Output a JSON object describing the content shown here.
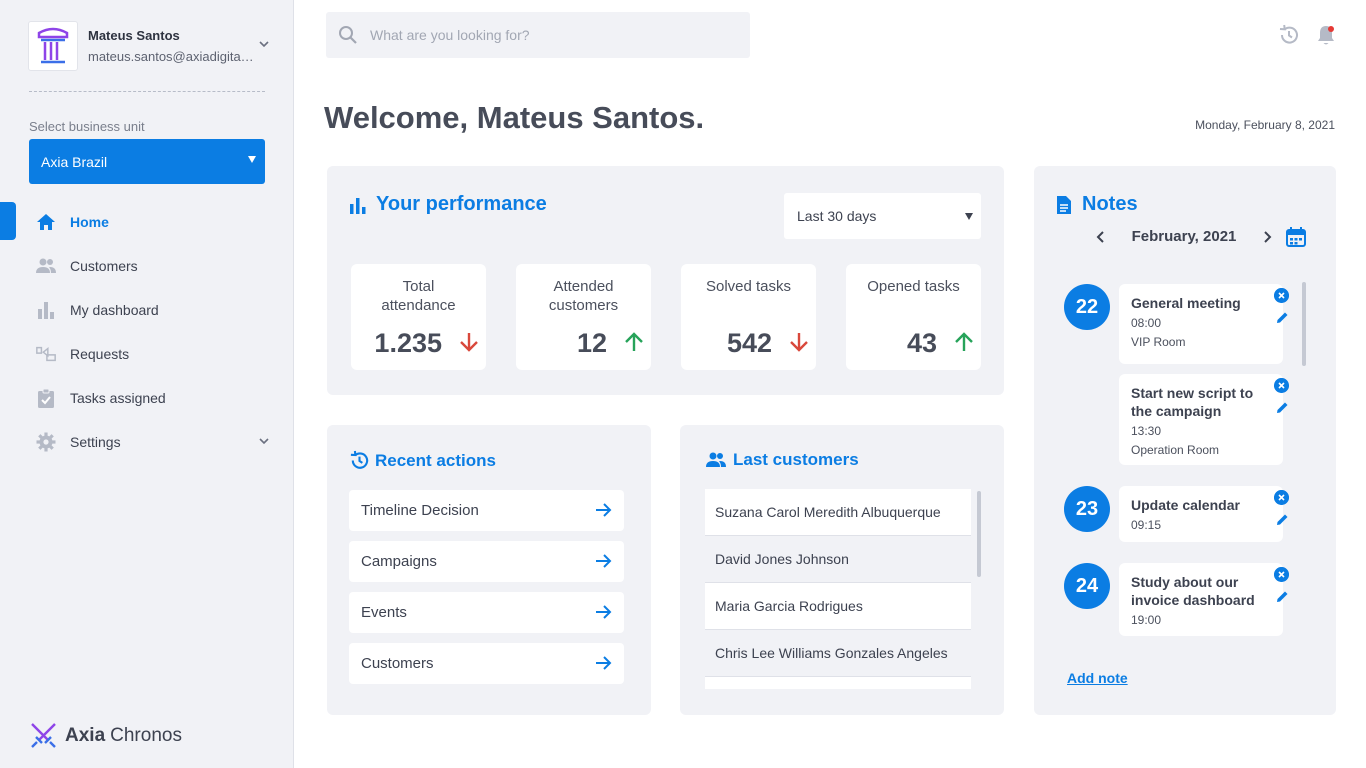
{
  "user": {
    "name": "Mateus Santos",
    "email": "mateus.santos@axiadigital.com"
  },
  "business_unit": {
    "label": "Select business unit",
    "selected": "Axia Brazil"
  },
  "nav": [
    {
      "label": "Home",
      "icon": "home-icon",
      "active": true
    },
    {
      "label": "Customers",
      "icon": "users-icon"
    },
    {
      "label": "My dashboard",
      "icon": "bar-chart-icon"
    },
    {
      "label": "Requests",
      "icon": "requests-icon"
    },
    {
      "label": "Tasks assigned",
      "icon": "clipboard-check-icon"
    },
    {
      "label": "Settings",
      "icon": "gear-icon"
    }
  ],
  "brand": {
    "primary": "Axia",
    "secondary": "Chronos"
  },
  "search": {
    "placeholder": "What are you looking for?"
  },
  "welcome": "Welcome, Mateus Santos.",
  "date": "Monday, February 8, 2021",
  "performance": {
    "title": "Your performance",
    "range": "Last 30 days",
    "kpis": [
      {
        "label": "Total attendance",
        "value": "1.235",
        "trend": "down"
      },
      {
        "label": "Attended customers",
        "value": "12",
        "trend": "up"
      },
      {
        "label": "Solved tasks",
        "value": "542",
        "trend": "down"
      },
      {
        "label": "Opened tasks",
        "value": "43",
        "trend": "up"
      }
    ]
  },
  "recent_actions": {
    "title": "Recent actions",
    "items": [
      "Timeline Decision",
      "Campaigns",
      "Events",
      "Customers"
    ]
  },
  "last_customers": {
    "title": "Last customers",
    "items": [
      "Suzana Carol Meredith Albuquerque",
      "David Jones Johnson",
      "Maria Garcia Rodrigues",
      "Chris Lee Williams Gonzales Angeles"
    ]
  },
  "notes": {
    "title": "Notes",
    "month": "February, 2021",
    "items": [
      {
        "day": "22",
        "title": "General meeting",
        "time": "08:00",
        "room": "VIP Room"
      },
      {
        "day": "",
        "title": "Start new script to the campaign",
        "time": "13:30",
        "room": "Operation Room"
      },
      {
        "day": "23",
        "title": "Update calendar",
        "time": "09:15",
        "room": ""
      },
      {
        "day": "24",
        "title": "Study about our invoice dashboard",
        "time": "19:00",
        "room": ""
      }
    ],
    "add_label": "Add note"
  },
  "colors": {
    "accent": "#0b7de3",
    "up": "#27a35a",
    "down": "#d9483b",
    "panel": "#f1f2f6"
  }
}
